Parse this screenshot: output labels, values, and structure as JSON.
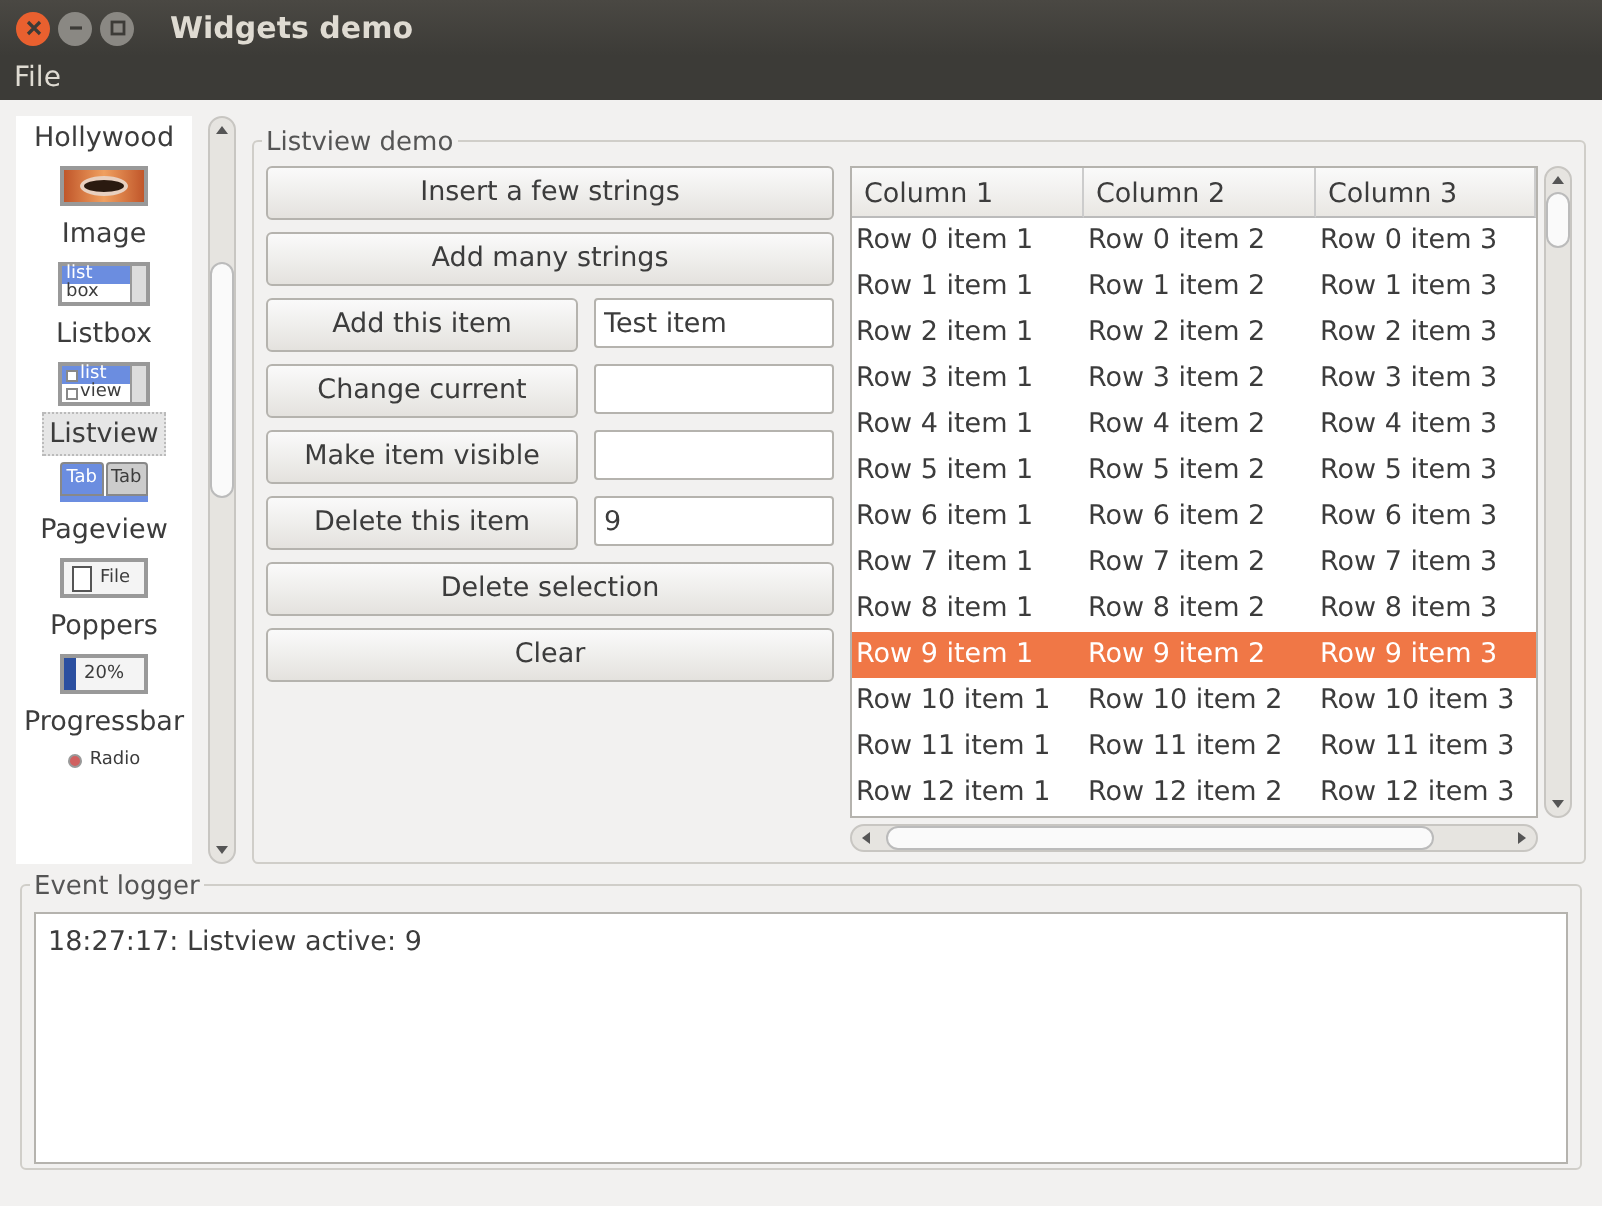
{
  "window": {
    "title": "Widgets demo"
  },
  "menu": [
    "File"
  ],
  "sidebar": {
    "items": [
      {
        "label": "Hollywood",
        "selected": false
      },
      {
        "kind": "eye",
        "label": "Image",
        "selected": false
      },
      {
        "kind": "listbox",
        "icon_text": [
          "list",
          "box"
        ],
        "label": "Listbox",
        "selected": false
      },
      {
        "kind": "listview",
        "icon_text": [
          "list",
          "view"
        ],
        "label": "Listview",
        "selected": true
      },
      {
        "kind": "tabs",
        "icon_text": [
          "Tab",
          "Tab"
        ],
        "label": "Pageview",
        "selected": false
      },
      {
        "kind": "file",
        "icon_text": [
          "File"
        ],
        "label": "Poppers",
        "selected": false
      },
      {
        "kind": "progress",
        "icon_text": [
          "20%"
        ],
        "label": "Progressbar",
        "selected": false
      },
      {
        "kind": "radio",
        "icon_text": [
          "Radio"
        ],
        "selected": false
      }
    ]
  },
  "demo": {
    "title": "Listview demo",
    "controls": [
      {
        "kind": "button",
        "button": "Insert a few strings"
      },
      {
        "kind": "button",
        "button": "Add many strings"
      },
      {
        "kind": "button_field",
        "button": "Add this item",
        "field_value": "Test item"
      },
      {
        "kind": "button_field",
        "button": "Change current"
      },
      {
        "kind": "button_field",
        "button": "Make item visible"
      },
      {
        "kind": "button_field",
        "button": "Delete this item",
        "field_value": "9"
      },
      {
        "kind": "button",
        "button": "Delete selection"
      },
      {
        "kind": "button",
        "button": "Clear"
      }
    ],
    "table": {
      "columns": [
        "Column 1",
        "Column 2",
        "Column 3"
      ],
      "rows": [
        {
          "cells": [
            "Row 0 item 1",
            "Row 0 item 2",
            "Row 0 item 3"
          ],
          "selected": false
        },
        {
          "cells": [
            "Row 1 item 1",
            "Row 1 item 2",
            "Row 1 item 3"
          ],
          "selected": false
        },
        {
          "cells": [
            "Row 2 item 1",
            "Row 2 item 2",
            "Row 2 item 3"
          ],
          "selected": false
        },
        {
          "cells": [
            "Row 3 item 1",
            "Row 3 item 2",
            "Row 3 item 3"
          ],
          "selected": false
        },
        {
          "cells": [
            "Row 4 item 1",
            "Row 4 item 2",
            "Row 4 item 3"
          ],
          "selected": false
        },
        {
          "cells": [
            "Row 5 item 1",
            "Row 5 item 2",
            "Row 5 item 3"
          ],
          "selected": false
        },
        {
          "cells": [
            "Row 6 item 1",
            "Row 6 item 2",
            "Row 6 item 3"
          ],
          "selected": false
        },
        {
          "cells": [
            "Row 7 item 1",
            "Row 7 item 2",
            "Row 7 item 3"
          ],
          "selected": false
        },
        {
          "cells": [
            "Row 8 item 1",
            "Row 8 item 2",
            "Row 8 item 3"
          ],
          "selected": false
        },
        {
          "cells": [
            "Row 9 item 1",
            "Row 9 item 2",
            "Row 9 item 3"
          ],
          "selected": true
        },
        {
          "cells": [
            "Row 10 item 1",
            "Row 10 item 2",
            "Row 10 item 3"
          ],
          "selected": false
        },
        {
          "cells": [
            "Row 11 item 1",
            "Row 11 item 2",
            "Row 11 item 3"
          ],
          "selected": false
        },
        {
          "cells": [
            "Row 12 item 1",
            "Row 12 item 2",
            "Row 12 item 3"
          ],
          "selected": false
        }
      ]
    }
  },
  "event_logger": {
    "title": "Event logger",
    "lines": [
      "18:27:17: Listview active: 9"
    ]
  }
}
